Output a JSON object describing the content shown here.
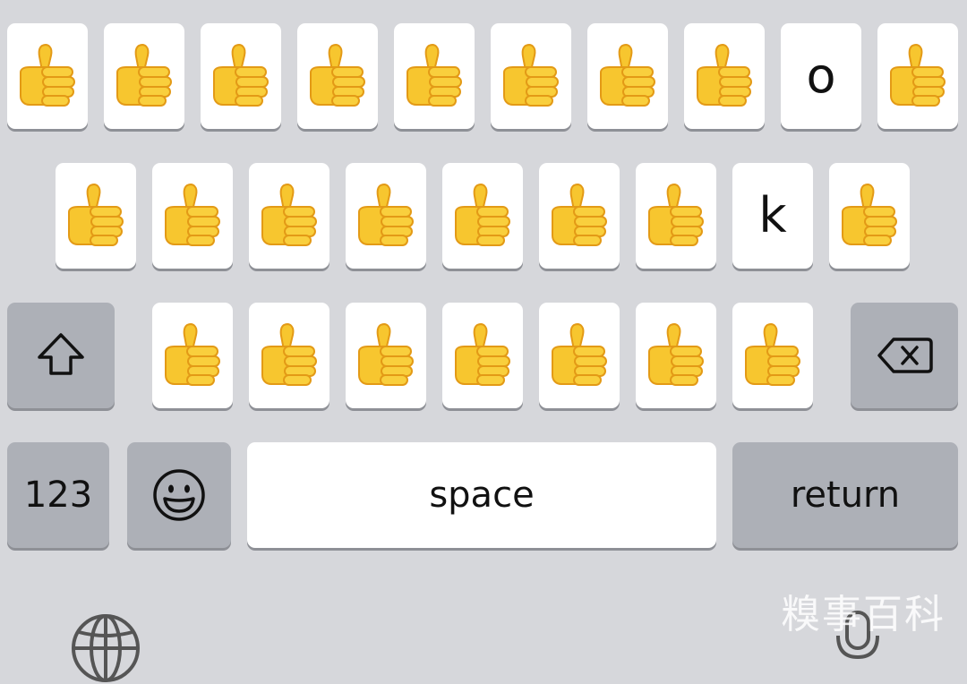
{
  "keyboard": {
    "row1": [
      "👍",
      "👍",
      "👍",
      "👍",
      "👍",
      "👍",
      "👍",
      "👍",
      "o",
      "👍"
    ],
    "row2": [
      "👍",
      "👍",
      "👍",
      "👍",
      "👍",
      "👍",
      "👍",
      "k",
      "👍"
    ],
    "row3": [
      "👍",
      "👍",
      "👍",
      "👍",
      "👍",
      "👍",
      "👍"
    ],
    "numbers_label": "123",
    "space_label": "space",
    "return_label": "return"
  },
  "icons": {
    "shift": "shift-icon",
    "delete": "delete-icon",
    "emoji": "emoji-icon",
    "globe": "globe-icon",
    "microphone": "microphone-icon",
    "thumbs_up": "thumbs-up-icon"
  },
  "watermark_text": "糗事百科",
  "colors": {
    "background": "#d6d7db",
    "key": "#ffffff",
    "special_key": "#adb0b7",
    "thumb_yellow": "#f7c62f",
    "thumb_dark": "#e39a16"
  }
}
